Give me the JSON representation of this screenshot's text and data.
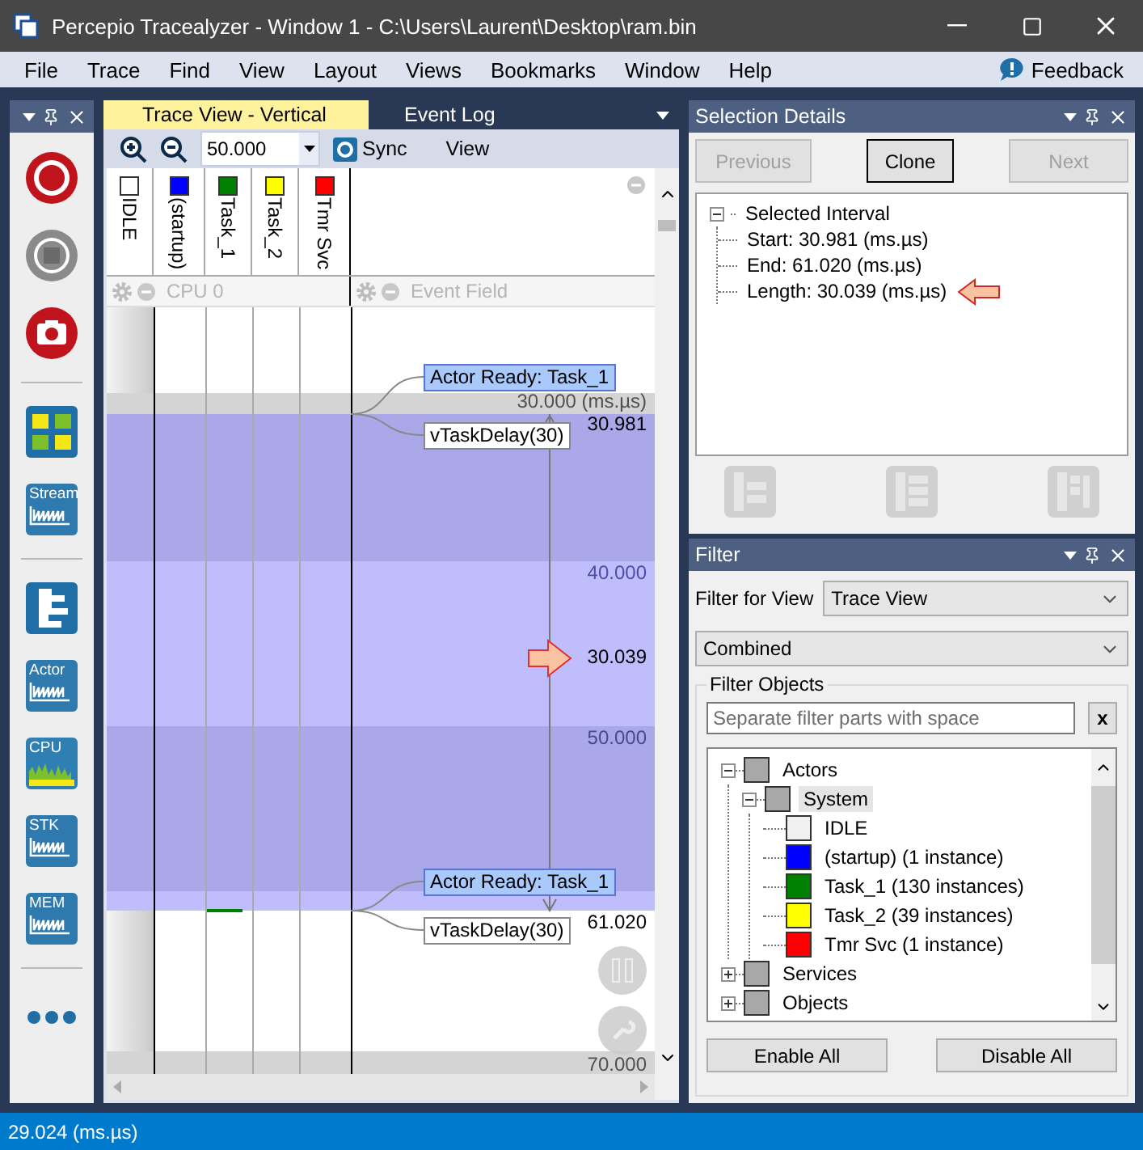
{
  "window": {
    "title": "Percepio Tracealyzer - Window 1 - C:\\Users\\Laurent\\Desktop\\ram.bin"
  },
  "menu": [
    "File",
    "Trace",
    "Find",
    "View",
    "Layout",
    "Views",
    "Bookmarks",
    "Window",
    "Help"
  ],
  "feedback": "Feedback",
  "tools": [
    {
      "kind": "record"
    },
    {
      "kind": "stop"
    },
    {
      "kind": "snapshot"
    },
    {
      "kind": "separator"
    },
    {
      "kind": "dashboard"
    },
    {
      "kind": "graph",
      "label": "Stream"
    },
    {
      "kind": "separator"
    },
    {
      "kind": "trace"
    },
    {
      "kind": "graph",
      "label": "Actor"
    },
    {
      "kind": "cpu",
      "label": "CPU"
    },
    {
      "kind": "graph",
      "label": "STK"
    },
    {
      "kind": "graph",
      "label": "MEM"
    },
    {
      "kind": "separator"
    },
    {
      "kind": "more"
    }
  ],
  "trace_view": {
    "tabs": [
      {
        "label": "Trace View - Vertical",
        "selected": true
      },
      {
        "label": "Event Log",
        "selected": false
      }
    ],
    "zoom_value": "50.000",
    "sync": "Sync",
    "view": "View",
    "columns": [
      {
        "label": "IDLE",
        "color": "#ffffff"
      },
      {
        "label": "(startup)",
        "color": "#0000ff"
      },
      {
        "label": "Task_1",
        "color": "#008000"
      },
      {
        "label": "Task_2",
        "color": "#ffff00"
      },
      {
        "label": "Tmr Svc",
        "color": "#ff0000"
      }
    ],
    "lanes": [
      "CPU 0",
      "Event Field"
    ],
    "time_labels": [
      "30.000 (ms.µs)",
      "40.000",
      "50.000",
      "70.000"
    ],
    "events": [
      {
        "kind": "ready",
        "label": "Actor Ready: Task_1"
      },
      {
        "kind": "delay",
        "label": "vTaskDelay(30)"
      },
      {
        "kind": "ready",
        "label": "Actor Ready: Task_1"
      },
      {
        "kind": "delay",
        "label": "vTaskDelay(30)"
      }
    ],
    "selection": {
      "start": "30.981",
      "end": "61.020",
      "length": "30.039"
    }
  },
  "selection_details": {
    "title": "Selection Details",
    "buttons": [
      {
        "label": "Previous",
        "disabled": true
      },
      {
        "label": "Clone",
        "disabled": false
      },
      {
        "label": "Next",
        "disabled": true
      }
    ],
    "tree": {
      "label": "Selected Interval",
      "expanded": true,
      "children": [
        {
          "label": "Start: 30.981 (ms.µs)",
          "pointer": false
        },
        {
          "label": "End: 61.020 (ms.µs)",
          "pointer": false
        },
        {
          "label": "Length: 30.039 (ms.µs)",
          "pointer": true
        }
      ]
    }
  },
  "filter": {
    "title": "Filter",
    "view_label": "Filter for View",
    "view_value": "Trace View",
    "mode": "Combined",
    "group_title": "Filter Objects",
    "search": {
      "placeholder": "Separate filter parts with space"
    },
    "clear": "x",
    "tree": [
      {
        "label": "Actors",
        "color": "#a8a8a8",
        "expanded": true,
        "selected": false,
        "children": [
          {
            "label": "System",
            "color": "#a8a8a8",
            "expanded": true,
            "selected": true,
            "children": [
              {
                "label": "IDLE",
                "color": "#f0f0f0",
                "selected": false
              },
              {
                "label": "(startup) (1 instance)",
                "color": "#0000ff",
                "selected": false
              },
              {
                "label": "Task_1 (130 instances)",
                "color": "#008000",
                "selected": false
              },
              {
                "label": "Task_2 (39 instances)",
                "color": "#ffff00",
                "selected": false
              },
              {
                "label": "Tmr Svc (1 instance)",
                "color": "#ff0000",
                "selected": false
              }
            ]
          }
        ]
      },
      {
        "label": "Services",
        "color": "#a8a8a8",
        "expanded": false,
        "selected": false
      },
      {
        "label": "Objects",
        "color": "#a8a8a8",
        "expanded": false,
        "selected": false
      }
    ],
    "buttons": [
      "Enable All",
      "Disable All"
    ]
  },
  "status": "29.024 (ms.µs)"
}
